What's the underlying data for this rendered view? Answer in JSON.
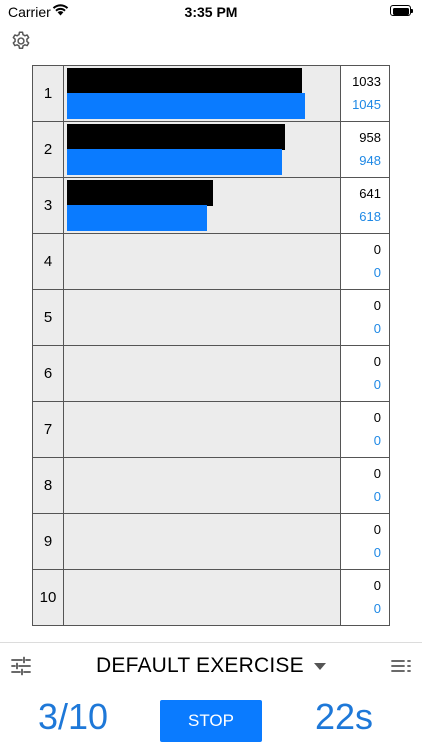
{
  "status_bar": {
    "carrier": "Carrier",
    "time": "3:35 PM"
  },
  "rows": [
    {
      "rank": "1",
      "target": 1033,
      "actual": 1045
    },
    {
      "rank": "2",
      "target": 958,
      "actual": 948
    },
    {
      "rank": "3",
      "target": 641,
      "actual": 618
    },
    {
      "rank": "4",
      "target": 0,
      "actual": 0
    },
    {
      "rank": "5",
      "target": 0,
      "actual": 0
    },
    {
      "rank": "6",
      "target": 0,
      "actual": 0
    },
    {
      "rank": "7",
      "target": 0,
      "actual": 0
    },
    {
      "rank": "8",
      "target": 0,
      "actual": 0
    },
    {
      "rank": "9",
      "target": 0,
      "actual": 0
    },
    {
      "rank": "10",
      "target": 0,
      "actual": 0
    }
  ],
  "bar_max_value": 1100,
  "colors": {
    "target_bar": "#000000",
    "actual_bar": "#0A7BFF",
    "accent_text": "#1E78D8"
  },
  "footer": {
    "exercise_name": "DEFAULT EXERCISE",
    "progress": "3/10",
    "stop_label": "STOP",
    "timer": "22s"
  },
  "icons": {
    "settings": "gear-icon",
    "tune": "sliders-icon",
    "list": "list-icon",
    "dropdown": "caret-down-icon"
  }
}
